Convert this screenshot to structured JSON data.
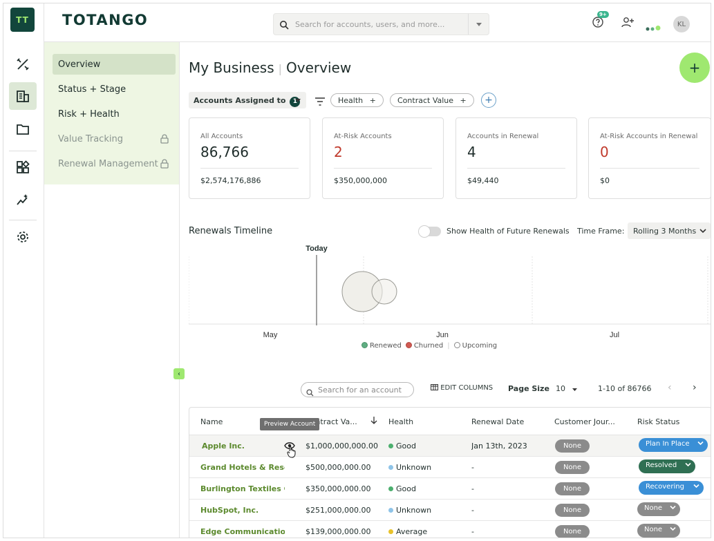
{
  "app": {
    "logo_text": "TT",
    "brand": "TOTANGO"
  },
  "topbar": {
    "search_placeholder": "Search for accounts, users, and more...",
    "notif_badge": "9+",
    "avatar_initials": "KL"
  },
  "rail": {
    "icons": [
      "tools-icon",
      "building-icon",
      "folder-icon",
      "widgets-icon",
      "sparkle-chart-icon",
      "gear-icon"
    ]
  },
  "subnav": {
    "items": [
      {
        "label": "Overview",
        "active": true,
        "locked": false
      },
      {
        "label": "Status + Stage",
        "active": false,
        "locked": false
      },
      {
        "label": "Risk + Health",
        "active": false,
        "locked": false
      },
      {
        "label": "Value Tracking",
        "active": false,
        "locked": true
      },
      {
        "label": "Renewal Management",
        "active": false,
        "locked": true
      }
    ]
  },
  "page": {
    "title": "My Business",
    "subtitle": "Overview"
  },
  "filters": {
    "assigned_label": "Accounts Assigned to",
    "assigned_count": "1",
    "pills": [
      "Health",
      "Contract Value"
    ]
  },
  "cards": [
    {
      "label": "All Accounts",
      "value": "86,766",
      "amount": "$2,574,176,886",
      "alert": false
    },
    {
      "label": "At-Risk Accounts",
      "value": "2",
      "amount": "$350,000,000",
      "alert": true
    },
    {
      "label": "Accounts in Renewal",
      "value": "4",
      "amount": "$49,440",
      "alert": false
    },
    {
      "label": "At-Risk Accounts in Renewal",
      "value": "0",
      "amount": "$0",
      "alert": true
    }
  ],
  "timeline": {
    "title": "Renewals Timeline",
    "toggle_label": "Show Health of Future Renewals",
    "toggle_on": false,
    "timeframe_label": "Time Frame:",
    "timeframe_value": "Rolling 3 Months",
    "today_label": "Today",
    "months": [
      "May",
      "Jun",
      "Jul"
    ],
    "legend": [
      {
        "label": "Renewed",
        "color": "#5fae82"
      },
      {
        "label": "Churned",
        "color": "#d05a52"
      },
      {
        "label": "Upcoming",
        "color": "#ffffff"
      }
    ]
  },
  "chart_data": {
    "type": "scatter",
    "title": "Renewals Timeline",
    "x_categories": [
      "May",
      "Jun",
      "Jul"
    ],
    "marker": "Today",
    "series": [
      {
        "name": "Upcoming",
        "points": [
          {
            "x_pos": 0.33,
            "size": "large"
          },
          {
            "x_pos": 0.37,
            "size": "small"
          }
        ]
      }
    ]
  },
  "table": {
    "search_placeholder": "Search for an account",
    "edit_columns": "EDIT COLUMNS",
    "page_size_label": "Page Size",
    "page_size": "10",
    "range": "1-10 of 86766",
    "columns": [
      "Name",
      "Contract Va...",
      "Health",
      "Renewal Date",
      "Customer Jour...",
      "Risk Status"
    ],
    "tooltip": "Preview Account",
    "rows": [
      {
        "name": "Apple Inc.",
        "contract": "$1,000,000,000.00",
        "health": "Good",
        "health_color": "#4caf6e",
        "renewal": "Jan 13th, 2023",
        "journey": "None",
        "risk": "Plan In Place",
        "risk_color": "#3a8fd6"
      },
      {
        "name": "Grand Hotels & Resor...",
        "contract": "$500,000,000.00",
        "health": "Unknown",
        "health_color": "#8fc4e8",
        "renewal": "-",
        "journey": "None",
        "risk": "Resolved",
        "risk_color": "#2f6f53"
      },
      {
        "name": "Burlington Textiles Co...",
        "contract": "$350,000,000.00",
        "health": "Good",
        "health_color": "#4caf6e",
        "renewal": "-",
        "journey": "None",
        "risk": "Recovering",
        "risk_color": "#3a8fd6"
      },
      {
        "name": "HubSpot, Inc.",
        "contract": "$251,000,000.00",
        "health": "Unknown",
        "health_color": "#8fc4e8",
        "renewal": "-",
        "journey": "None",
        "risk": "None",
        "risk_color": "#8b8b8b"
      },
      {
        "name": "Edge Communicatio...",
        "contract": "$139,000,000.00",
        "health": "Average",
        "health_color": "#e8c22b",
        "renewal": "-",
        "journey": "None",
        "risk": "None",
        "risk_color": "#8b8b8b"
      }
    ]
  }
}
